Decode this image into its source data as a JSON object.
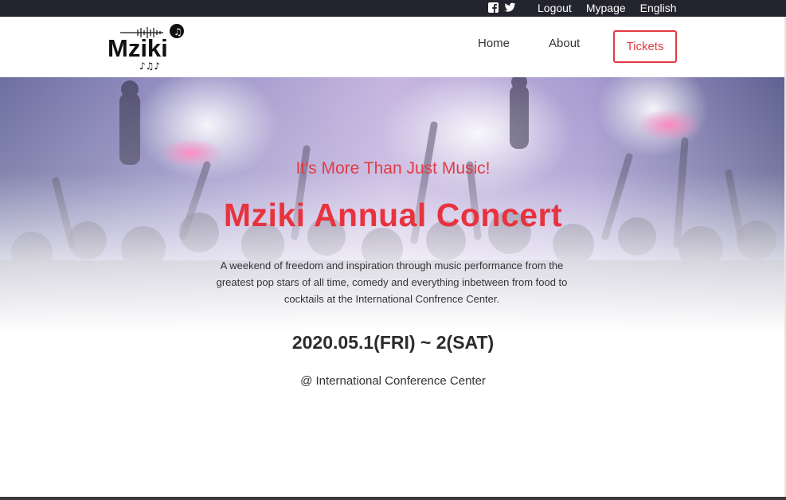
{
  "topbar": {
    "links": [
      "Logout",
      "Mypage",
      "English"
    ],
    "social_icons": [
      "facebook-icon",
      "twitter-icon"
    ]
  },
  "header": {
    "logo_text": "Mziki",
    "nav": {
      "home": "Home",
      "about": "About",
      "tickets": "Tickets"
    }
  },
  "hero": {
    "tagline": "It's More Than Just Music!",
    "title": "Mziki Annual Concert",
    "description": "A weekend of freedom and inspiration through music performance from the greatest pop stars of all time, comedy and everything inbetween from food to cocktails at the International Confrence Center.",
    "date": "2020.05.1(FRI) ~ 2(SAT)",
    "venue": "@ International Conference Center"
  },
  "colors": {
    "accent": "#e23a44",
    "topbar": "#24242e",
    "text": "#333333"
  }
}
